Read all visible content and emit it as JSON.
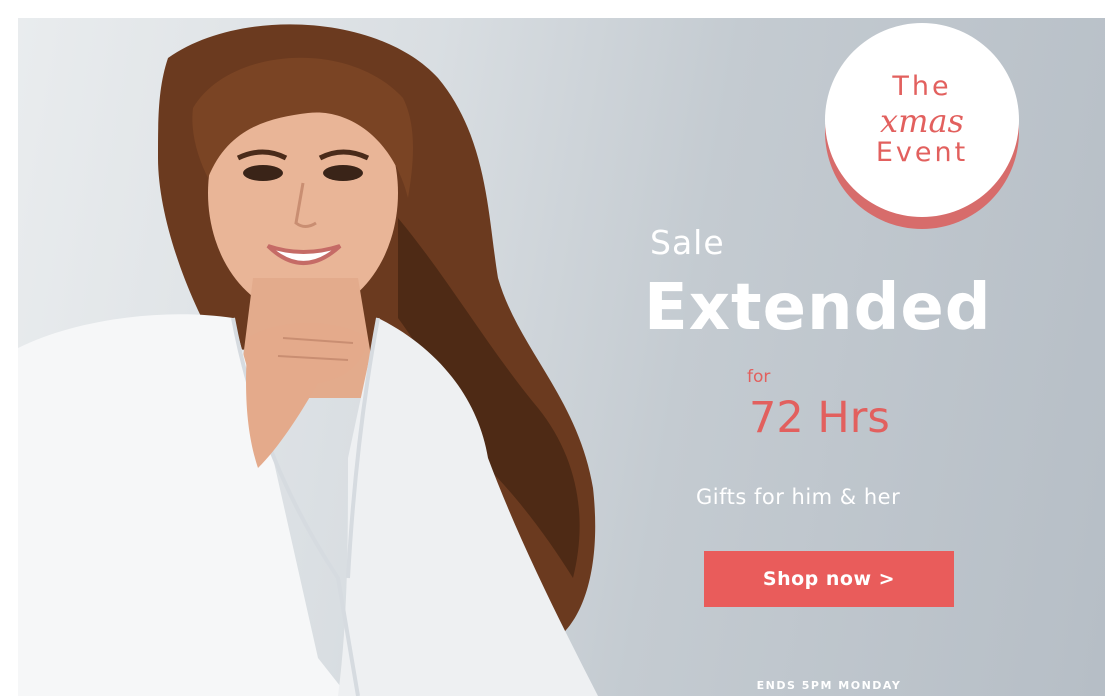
{
  "badge": {
    "line1": "The",
    "line2": "xmas",
    "line3": "Event"
  },
  "headline": {
    "sale": "Sale",
    "extended": "Extended"
  },
  "duration": {
    "prefix": "for",
    "hours": "72 Hrs"
  },
  "subtitle": "Gifts for him & her",
  "cta": {
    "label": "Shop now >"
  },
  "footer_note": "ENDS 5PM MONDAY",
  "colors": {
    "accent": "#e95c5b",
    "badge_shadow": "#d76c6b",
    "text_light": "#ffffff"
  }
}
